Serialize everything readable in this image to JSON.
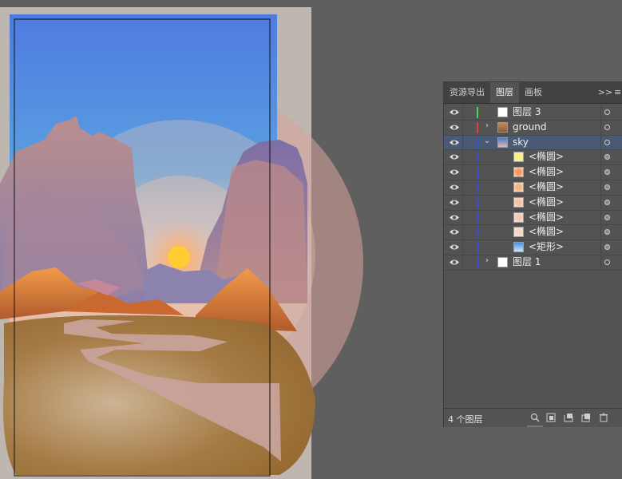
{
  "panel": {
    "tabs": [
      {
        "label": "资源导出"
      },
      {
        "label": "图层"
      },
      {
        "label": "画板"
      }
    ],
    "collapse_label": ">>",
    "menu_label": "≡",
    "layers": [
      {
        "name": "图层 3",
        "color": "#4fd44f",
        "thumb": "white",
        "expandable": false,
        "indent": 0,
        "selected": false
      },
      {
        "name": "ground",
        "color": "#e0413b",
        "thumb": "ground",
        "expandable": true,
        "expanded": false,
        "indent": 0,
        "selected": false
      },
      {
        "name": "sky",
        "color": "#3a4fd8",
        "thumb": "sky",
        "expandable": true,
        "expanded": true,
        "indent": 0,
        "selected": true
      },
      {
        "name": "<椭圆>",
        "color": "#3a4fd8",
        "thumb": "#f7ef86",
        "expandable": false,
        "indent": 1,
        "selected": false
      },
      {
        "name": "<椭圆>",
        "color": "#3a4fd8",
        "thumb": "#f19b63",
        "expandable": false,
        "indent": 1,
        "selected": false
      },
      {
        "name": "<椭圆>",
        "color": "#3a4fd8",
        "thumb": "#f3b57f",
        "expandable": false,
        "indent": 1,
        "selected": false
      },
      {
        "name": "<椭圆>",
        "color": "#3a4fd8",
        "thumb": "#f3c0a8",
        "expandable": false,
        "indent": 1,
        "selected": false
      },
      {
        "name": "<椭圆>",
        "color": "#3a4fd8",
        "thumb": "#f2c8b6",
        "expandable": false,
        "indent": 1,
        "selected": false
      },
      {
        "name": "<椭圆>",
        "color": "#3a4fd8",
        "thumb": "#f5d6cb",
        "expandable": false,
        "indent": 1,
        "selected": false
      },
      {
        "name": "<矩形>",
        "color": "#3a4fd8",
        "thumb": "rect",
        "expandable": false,
        "indent": 1,
        "selected": false
      },
      {
        "name": "图层 1",
        "color": "#3a4fd8",
        "thumb": "white",
        "expandable": true,
        "expanded": false,
        "indent": 0,
        "selected": false
      }
    ],
    "footer": {
      "count_label": "4 个图层"
    }
  }
}
